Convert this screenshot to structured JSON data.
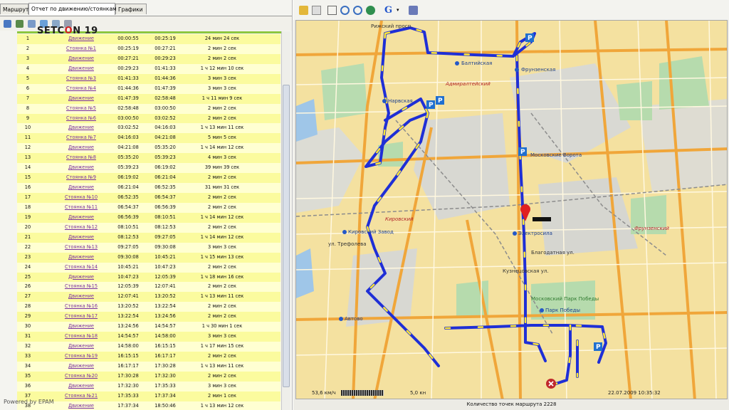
{
  "tabs": [
    "Маршрут",
    "Отчет по движению/стоянкам",
    "Графики"
  ],
  "logo": {
    "pre": "SETC",
    "o": "O",
    "post": "N 19"
  },
  "powered": "Powered by EPAM",
  "rows": [
    [
      "1",
      "Движение",
      "00:00:55",
      "00:25:19",
      "24 мин 24 сек"
    ],
    [
      "2",
      "Стоянка №1",
      "00:25:19",
      "00:27:21",
      "2 мин 2 сек"
    ],
    [
      "3",
      "Движение",
      "00:27:21",
      "00:29:23",
      "2 мин 2 сек"
    ],
    [
      "4",
      "Движение",
      "00:29:23",
      "01:41:33",
      "1 ч 12 мин 10 сек"
    ],
    [
      "5",
      "Стоянка №3",
      "01:41:33",
      "01:44:36",
      "3 мин 3 сек"
    ],
    [
      "6",
      "Стоянка №4",
      "01:44:36",
      "01:47:39",
      "3 мин 3 сек"
    ],
    [
      "7",
      "Движение",
      "01:47:39",
      "02:58:48",
      "1 ч 11 мин 9 сек"
    ],
    [
      "8",
      "Стоянка №5",
      "02:58:48",
      "03:00:50",
      "2 мин 2 сек"
    ],
    [
      "9",
      "Стоянка №6",
      "03:00:50",
      "03:02:52",
      "2 мин 2 сек"
    ],
    [
      "10",
      "Движение",
      "03:02:52",
      "04:16:03",
      "1 ч 13 мин 11 сек"
    ],
    [
      "11",
      "Стоянка №7",
      "04:16:03",
      "04:21:08",
      "5 мин 5 сек"
    ],
    [
      "12",
      "Движение",
      "04:21:08",
      "05:35:20",
      "1 ч 14 мин 12 сек"
    ],
    [
      "13",
      "Стоянка №8",
      "05:35:20",
      "05:39:23",
      "4 мин 3 сек"
    ],
    [
      "14",
      "Движение",
      "05:39:23",
      "06:19:02",
      "39 мин 39 сек"
    ],
    [
      "15",
      "Стоянка №9",
      "06:19:02",
      "06:21:04",
      "2 мин 2 сек"
    ],
    [
      "16",
      "Движение",
      "06:21:04",
      "06:52:35",
      "31 мин 31 сек"
    ],
    [
      "17",
      "Стоянка №10",
      "06:52:35",
      "06:54:37",
      "2 мин 2 сек"
    ],
    [
      "18",
      "Стоянка №11",
      "06:54:37",
      "06:56:39",
      "2 мин 2 сек"
    ],
    [
      "19",
      "Движение",
      "06:56:39",
      "08:10:51",
      "1 ч 14 мин 12 сек"
    ],
    [
      "20",
      "Стоянка №12",
      "08:10:51",
      "08:12:53",
      "2 мин 2 сек"
    ],
    [
      "21",
      "Движение",
      "08:12:53",
      "09:27:05",
      "1 ч 14 мин 12 сек"
    ],
    [
      "22",
      "Стоянка №13",
      "09:27:05",
      "09:30:08",
      "3 мин 3 сек"
    ],
    [
      "23",
      "Движение",
      "09:30:08",
      "10:45:21",
      "1 ч 15 мин 13 сек"
    ],
    [
      "24",
      "Стоянка №14",
      "10:45:21",
      "10:47:23",
      "2 мин 2 сек"
    ],
    [
      "25",
      "Движение",
      "10:47:23",
      "12:05:39",
      "1 ч 18 мин 16 сек"
    ],
    [
      "26",
      "Стоянка №15",
      "12:05:39",
      "12:07:41",
      "2 мин 2 сек"
    ],
    [
      "27",
      "Движение",
      "12:07:41",
      "13:20:52",
      "1 ч 13 мин 11 сек"
    ],
    [
      "28",
      "Стоянка №16",
      "13:20:52",
      "13:22:54",
      "2 мин 2 сек"
    ],
    [
      "29",
      "Стоянка №17",
      "13:22:54",
      "13:24:56",
      "2 мин 2 сек"
    ],
    [
      "30",
      "Движение",
      "13:24:56",
      "14:54:57",
      "1 ч 30 мин 1 сек"
    ],
    [
      "31",
      "Стоянка №18",
      "14:54:57",
      "14:58:00",
      "3 мин 3 сек"
    ],
    [
      "32",
      "Движение",
      "14:58:00",
      "16:15:15",
      "1 ч 17 мин 15 сек"
    ],
    [
      "33",
      "Стоянка №19",
      "16:15:15",
      "16:17:17",
      "2 мин 2 сек"
    ],
    [
      "34",
      "Движение",
      "16:17:17",
      "17:30:28",
      "1 ч 13 мин 11 сек"
    ],
    [
      "35",
      "Стоянка №20",
      "17:30:28",
      "17:32:30",
      "2 мин 2 сек"
    ],
    [
      "36",
      "Движение",
      "17:32:30",
      "17:35:33",
      "3 мин 3 сек"
    ],
    [
      "37",
      "Стоянка №21",
      "17:35:33",
      "17:37:34",
      "2 мин 1 сек"
    ],
    [
      "38",
      "Движение",
      "17:37:34",
      "18:50:46",
      "1 ч 13 мин 12 сек"
    ]
  ],
  "map": {
    "status": "Количество точек маршрута 2228",
    "speed": "53,6 км/ч",
    "kn": "5,0 кн",
    "timestamp": "22.07.2009 10:35:32",
    "labels": {
      "rizh": "Рижский просп.",
      "balt": "Балтийская",
      "frunz": "Фрунзенская",
      "admir": "Адмиралтейский",
      "narv": "Нарвская",
      "mosk": "Московские Ворота",
      "kirov": "Кировский",
      "kirovzavod": "Кировский Завод",
      "elektro": "Электросила",
      "park": "Парк Победы",
      "avtovo": "Автово",
      "moskparkpob": "Московский Парк Победы",
      "frunzrayon": "Фрунзенский",
      "kuzn": "Кузнецовская ул.",
      "blago": "Благодатная ул.",
      "trefoleva": "ул. Трефолева"
    }
  }
}
